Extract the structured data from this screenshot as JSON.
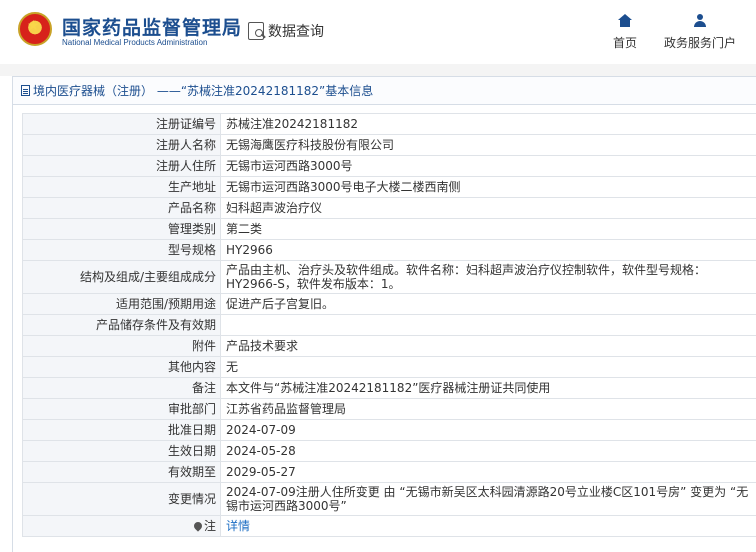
{
  "header": {
    "site_title_cn": "国家药品监督管理局",
    "site_title_en": "National Medical Products Administration",
    "query_label": "数据查询",
    "nav": [
      {
        "label": "首页",
        "icon": "home-icon"
      },
      {
        "label": "政务服务门户",
        "icon": "user-icon"
      }
    ]
  },
  "panel": {
    "title": "境内医疗器械（注册） ——“苏械注准20242181182”基本信息"
  },
  "rows": [
    {
      "label": "注册证编号",
      "value": "苏械注准20242181182"
    },
    {
      "label": "注册人名称",
      "value": "无锡海鹰医疗科技股份有限公司"
    },
    {
      "label": "注册人住所",
      "value": "无锡市运河西路3000号"
    },
    {
      "label": "生产地址",
      "value": "无锡市运河西路3000号电子大楼二楼西南侧"
    },
    {
      "label": "产品名称",
      "value": "妇科超声波治疗仪"
    },
    {
      "label": "管理类别",
      "value": "第二类"
    },
    {
      "label": "型号规格",
      "value": "HY2966"
    },
    {
      "label": "结构及组成/主要组成成分",
      "value": "产品由主机、治疗头及软件组成。软件名称：妇科超声波治疗仪控制软件，软件型号规格：HY2966-S，软件发布版本：1。"
    },
    {
      "label": "适用范围/预期用途",
      "value": "促进产后子宫复旧。"
    },
    {
      "label": "产品储存条件及有效期",
      "value": ""
    },
    {
      "label": "附件",
      "value": "产品技术要求"
    },
    {
      "label": "其他内容",
      "value": "无"
    },
    {
      "label": "备注",
      "value": "本文件与“苏械注准20242181182”医疗器械注册证共同使用"
    },
    {
      "label": "审批部门",
      "value": "江苏省药品监督管理局"
    },
    {
      "label": "批准日期",
      "value": "2024-07-09"
    },
    {
      "label": "生效日期",
      "value": "2024-05-28"
    },
    {
      "label": "有效期至",
      "value": "2029-05-27"
    },
    {
      "label": "变更情况",
      "value": "2024-07-09注册人住所变更 由 “无锡市新吴区太科园清源路20号立业楼C区101号房” 变更为 “无锡市运河西路3000号”"
    },
    {
      "label": "注",
      "value": "详情",
      "icon": "pin-icon"
    }
  ]
}
